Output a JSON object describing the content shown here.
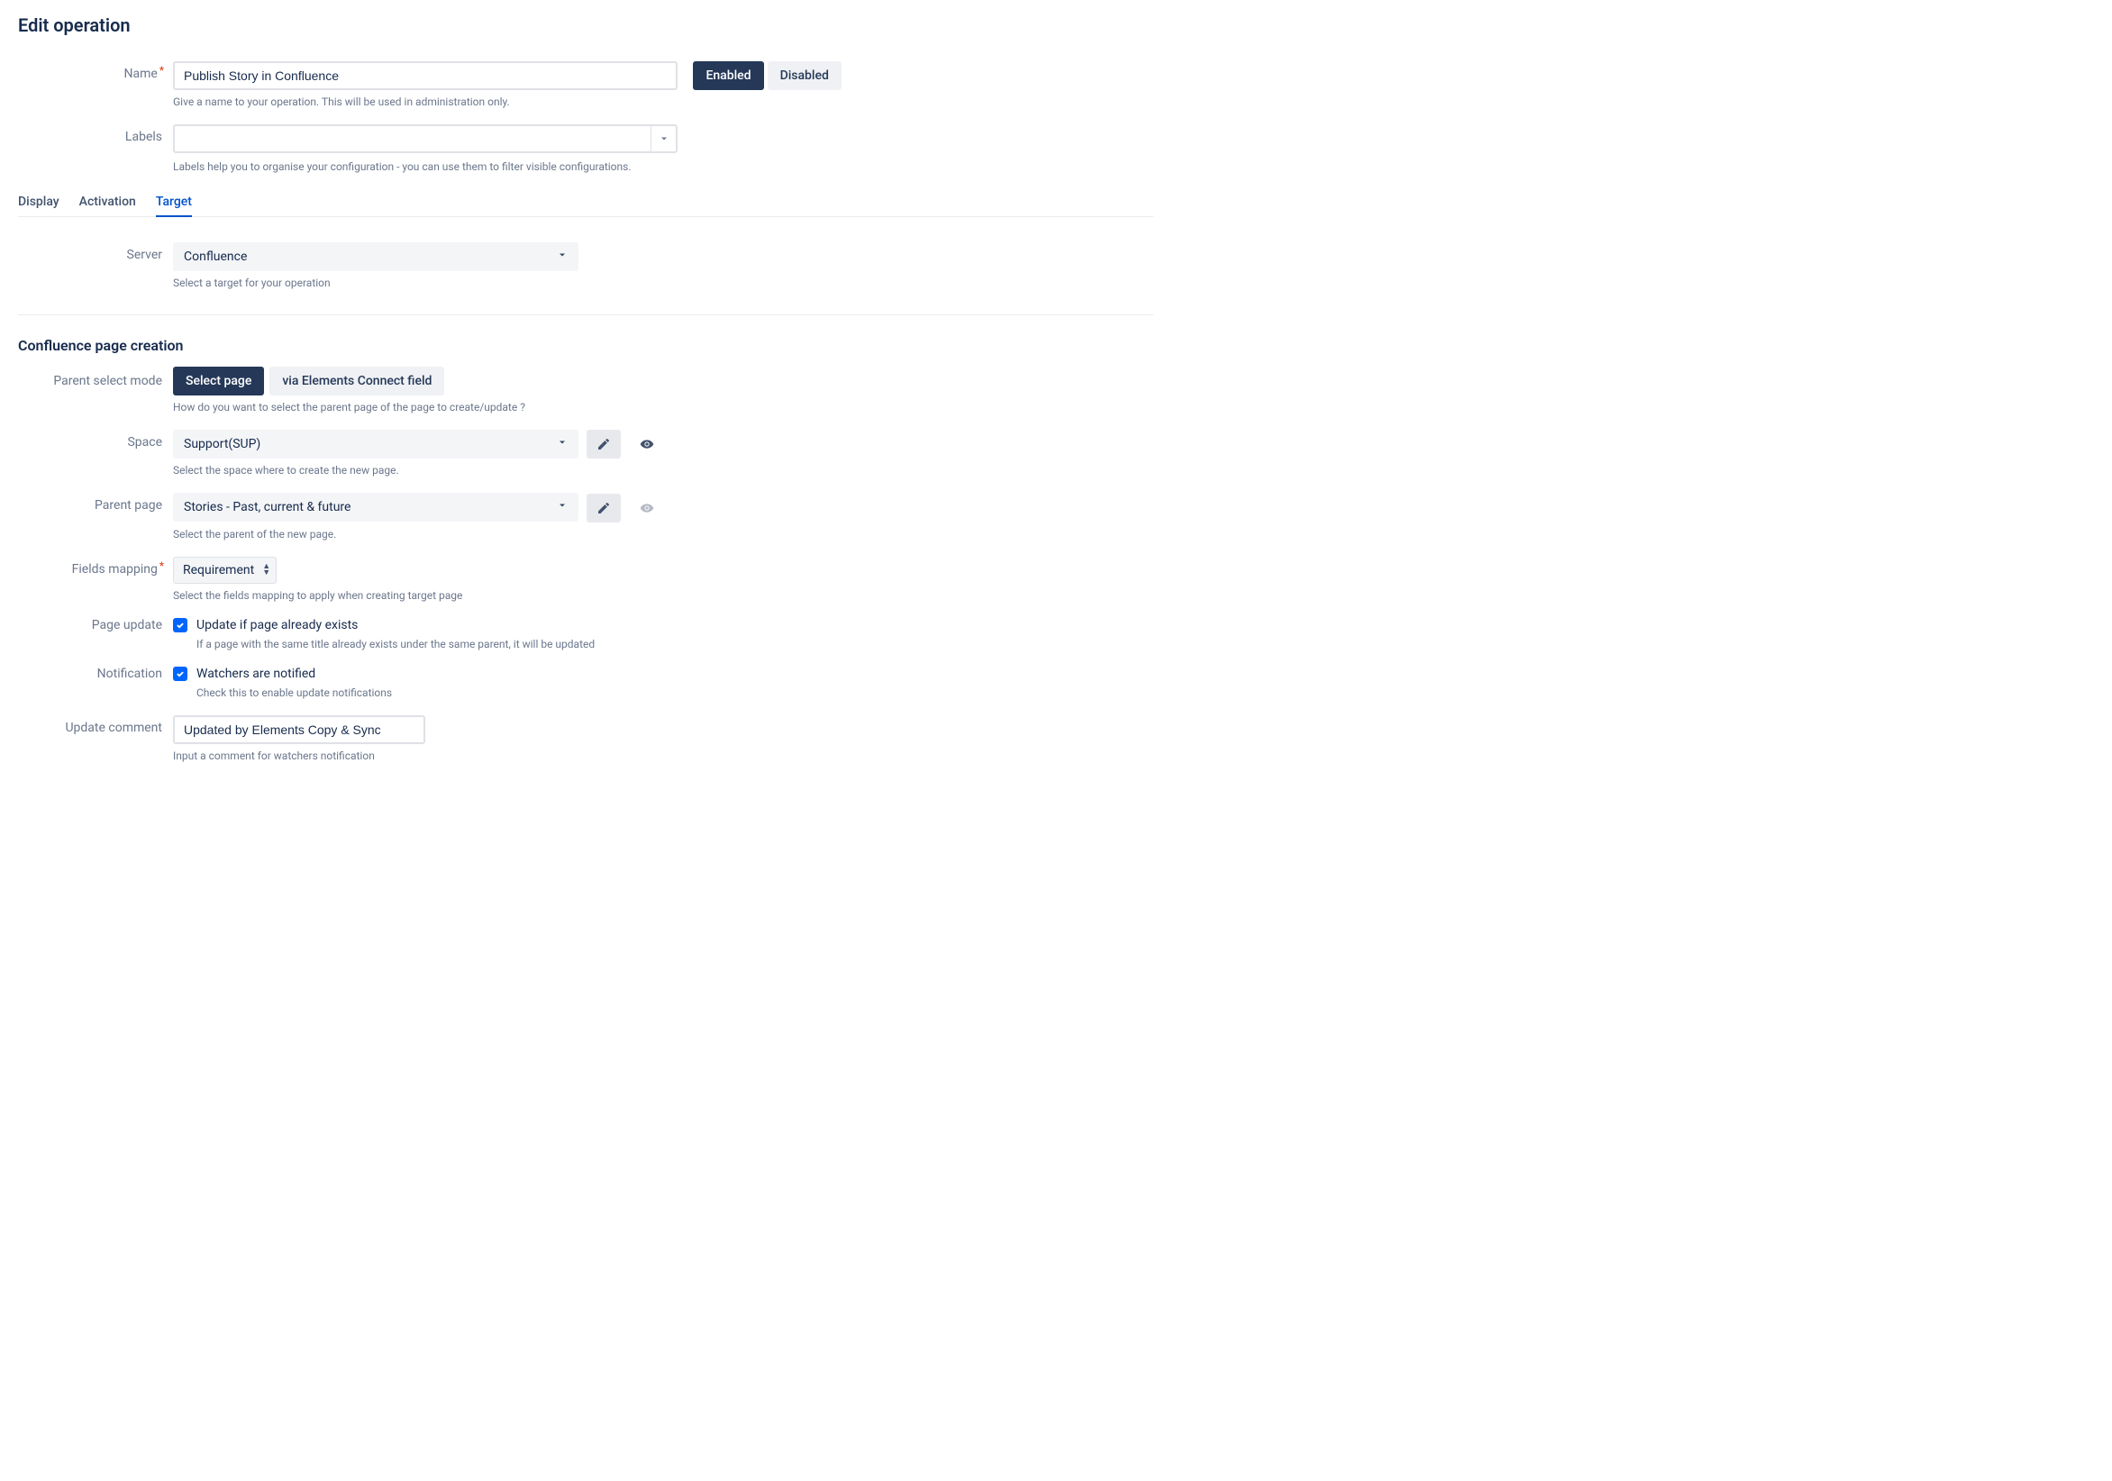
{
  "page_title": "Edit operation",
  "name": {
    "label": "Name",
    "value": "Publish Story in Confluence",
    "helper": "Give a name to your operation. This will be used in administration only."
  },
  "status_toggle": {
    "enabled_label": "Enabled",
    "disabled_label": "Disabled"
  },
  "labels": {
    "label": "Labels",
    "helper": "Labels help you to organise your configuration - you can use them to filter visible configurations."
  },
  "tabs": {
    "display": "Display",
    "activation": "Activation",
    "target": "Target"
  },
  "server": {
    "label": "Server",
    "value": "Confluence",
    "helper": "Select a target for your operation"
  },
  "section_title": "Confluence page creation",
  "parent_mode": {
    "label": "Parent select mode",
    "select_page": "Select page",
    "via_field": "via Elements Connect field",
    "helper": "How do you want to select the parent page of the page to create/update ?"
  },
  "space": {
    "label": "Space",
    "value": "Support(SUP)",
    "helper": "Select the space where to create the new page."
  },
  "parent_page": {
    "label": "Parent page",
    "value": "Stories - Past, current & future",
    "helper": "Select the parent of the new page."
  },
  "fields_mapping": {
    "label": "Fields mapping",
    "value": "Requirement",
    "helper": "Select the fields mapping to apply when creating target page"
  },
  "page_update": {
    "label": "Page update",
    "checkbox_label": "Update if page already exists",
    "helper": "If a page with the same title already exists under the same parent, it will be updated"
  },
  "notification": {
    "label": "Notification",
    "checkbox_label": "Watchers are notified",
    "helper": "Check this to enable update notifications"
  },
  "update_comment": {
    "label": "Update comment",
    "value": "Updated by Elements Copy & Sync",
    "helper": "Input a comment for watchers notification"
  }
}
